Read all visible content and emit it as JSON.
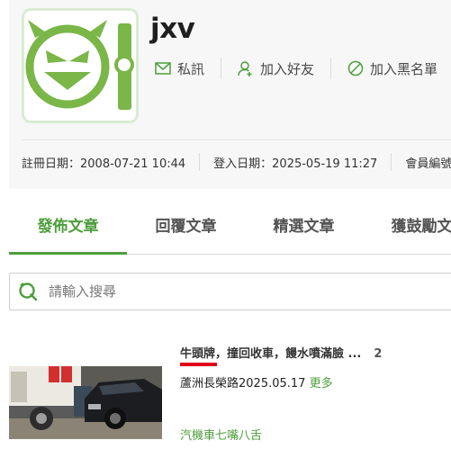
{
  "profile": {
    "username": "jxv",
    "actions": [
      {
        "label": "私訊",
        "icon": "mail-icon"
      },
      {
        "label": "加入好友",
        "icon": "add-friend-icon"
      },
      {
        "label": "加入黑名單",
        "icon": "block-icon"
      }
    ],
    "register_date": "註冊日期：2008-07-21 10:44",
    "login_date": "登入日期：2025-05-19 11:27",
    "member_no": "會員編號"
  },
  "tabs": [
    "發佈文章",
    "回覆文章",
    "精選文章",
    "獲鼓勵文"
  ],
  "active_tab": 0,
  "search": {
    "placeholder": "請輸入搜尋",
    "value": ""
  },
  "post": {
    "title_keyword": "牛頭牌",
    "title_rest": "，撞回收車，饅水噴滿臉 ...",
    "reply_count": "2",
    "excerpt": "蘆洲長榮路2025.05.17",
    "more": "更多",
    "board": "汽機車七嘴八舌"
  },
  "colors": {
    "accent": "#4d9e3c",
    "highlight_underline": "#e0001a",
    "avatar_green": "#7ab648"
  }
}
